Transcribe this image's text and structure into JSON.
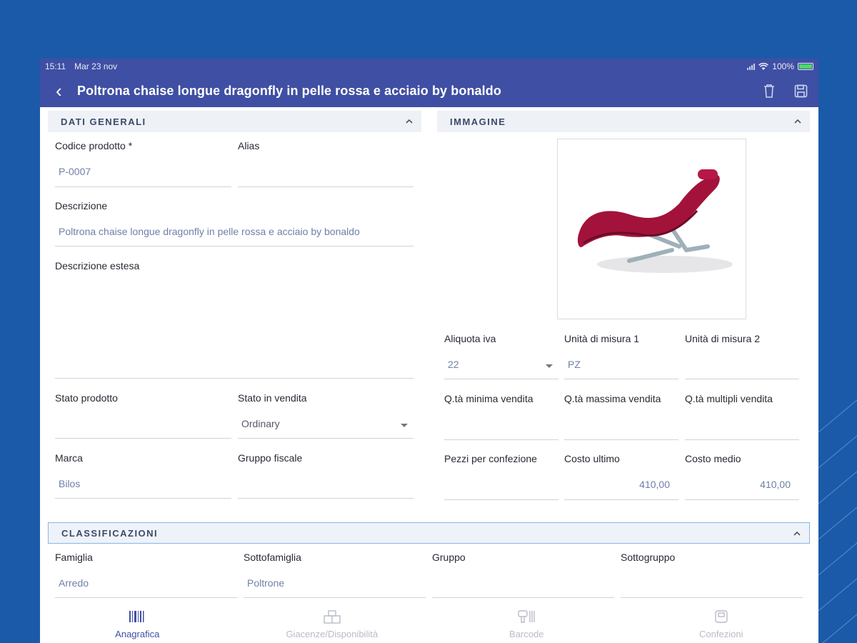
{
  "status": {
    "time": "15:11",
    "date": "Mar 23 nov",
    "battery": "100%"
  },
  "header": {
    "title": "Poltrona chaise longue dragonfly in pelle rossa e acciaio by bonaldo"
  },
  "general": {
    "title": "DATI GENERALI",
    "code_label": "Codice prodotto *",
    "code_value": "P-0007",
    "alias_label": "Alias",
    "alias_value": "",
    "desc_label": "Descrizione",
    "desc_value": "Poltrona chaise longue dragonfly in pelle rossa e acciaio by bonaldo",
    "ext_desc_label": "Descrizione estesa",
    "ext_desc_value": "",
    "state_label": "Stato prodotto",
    "state_value": "",
    "sale_state_label": "Stato in vendita",
    "sale_state_value": "Ordinary",
    "brand_label": "Marca",
    "brand_value": "Bilos",
    "fiscal_label": "Gruppo fiscale",
    "fiscal_value": ""
  },
  "image": {
    "title": "IMMAGINE",
    "vat_label": "Aliquota iva",
    "vat_value": "22",
    "um1_label": "Unità di misura 1",
    "um1_value": "PZ",
    "um2_label": "Unità di misura 2",
    "um2_value": "",
    "qmin_label": "Q.tà minima vendita",
    "qmin_value": "",
    "qmax_label": "Q.tà massima vendita",
    "qmax_value": "",
    "qmul_label": "Q.tà multipli vendita",
    "qmul_value": "",
    "pcs_label": "Pezzi per confezione",
    "pcs_value": "",
    "last_cost_label": "Costo ultimo",
    "last_cost_value": "410,00",
    "avg_cost_label": "Costo medio",
    "avg_cost_value": "410,00"
  },
  "classification": {
    "title": "CLASSIFICAZIONI",
    "family_label": "Famiglia",
    "family_value": "Arredo",
    "subfamily_label": "Sottofamiglia",
    "subfamily_value": "Poltrone",
    "group_label": "Gruppo",
    "group_value": "",
    "subgroup_label": "Sottogruppo",
    "subgroup_value": ""
  },
  "tabs": [
    {
      "label": "Anagrafica",
      "icon": "barcode-icon",
      "active": true
    },
    {
      "label": "Giacenze/Disponibilità",
      "icon": "warehouse-icon",
      "active": false
    },
    {
      "label": "Barcode",
      "icon": "barcode-scanner-icon",
      "active": false
    },
    {
      "label": "Confezioni",
      "icon": "package-icon",
      "active": false
    }
  ],
  "colors": {
    "appbar": "#3f4fa3",
    "background": "#1b5aa8",
    "value_text": "#6f7fa8"
  }
}
